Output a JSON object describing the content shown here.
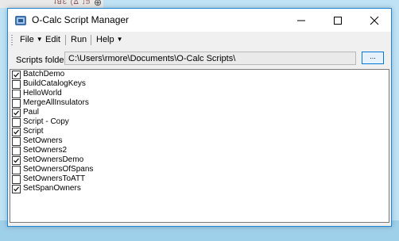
{
  "background": {
    "scale_text": "ʇꓭƐ (ᐃ ˩ᴝ"
  },
  "window": {
    "title": "O-Calc Script Manager",
    "accent_color": "#1e88d6"
  },
  "menu": {
    "file": "File",
    "edit": "Edit",
    "run": "Run",
    "help": "Help"
  },
  "folder": {
    "label": "Scripts folder:",
    "path": "C:\\Users\\rmore\\Documents\\O-Calc Scripts\\",
    "browse_label": "..."
  },
  "scripts": [
    {
      "name": "BatchDemo",
      "checked": true
    },
    {
      "name": "BuildCatalogKeys",
      "checked": false
    },
    {
      "name": "HelloWorld",
      "checked": false
    },
    {
      "name": "MergeAllInsulators",
      "checked": false
    },
    {
      "name": "Paul",
      "checked": true
    },
    {
      "name": "Script - Copy",
      "checked": false
    },
    {
      "name": "Script",
      "checked": true
    },
    {
      "name": "SetOwners",
      "checked": false
    },
    {
      "name": "SetOwners2",
      "checked": false
    },
    {
      "name": "SetOwnersDemo",
      "checked": true
    },
    {
      "name": "SetOwnersOfSpans",
      "checked": false
    },
    {
      "name": "SetOwnersToATT",
      "checked": false
    },
    {
      "name": "SetSpanOwners",
      "checked": true
    }
  ]
}
